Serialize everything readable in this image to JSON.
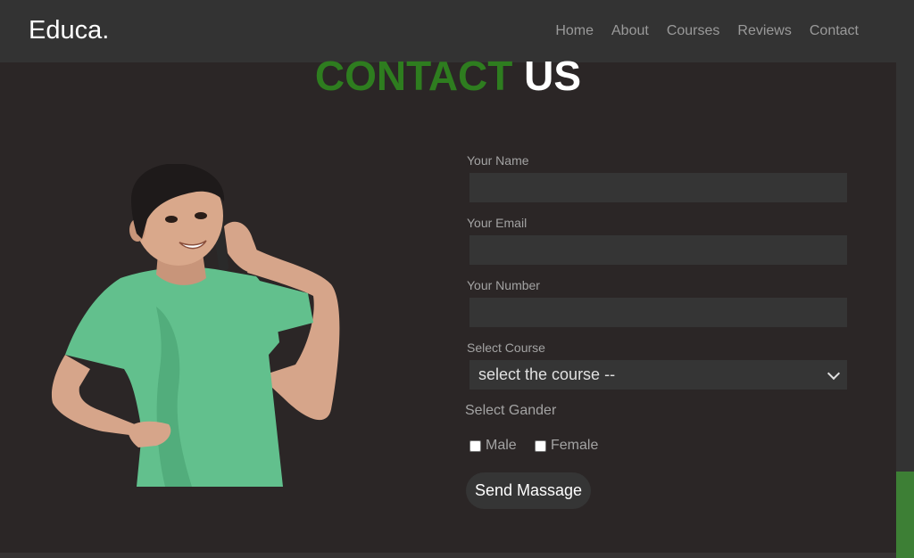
{
  "navbar": {
    "logo": "Educa.",
    "links": [
      "Home",
      "About",
      "Courses",
      "Reviews",
      "Contact"
    ]
  },
  "heading": {
    "part1": "CONTACT",
    "part2": "US"
  },
  "form": {
    "name_label": "Your Name",
    "name_value": "",
    "email_label": "Your Email",
    "email_value": "",
    "number_label": "Your Number",
    "number_value": "",
    "course_label": "Select Course",
    "course_selected": "select the course --",
    "gender_label": "Select Gander",
    "gender_options": [
      "Male",
      "Female"
    ],
    "submit_label": "Send Massage"
  },
  "colors": {
    "accent": "#2e7d1f",
    "background": "#2b2626",
    "navbar": "#333333",
    "field": "#353535"
  },
  "illustration": "boy-in-green-shirt-talking-on-phone"
}
